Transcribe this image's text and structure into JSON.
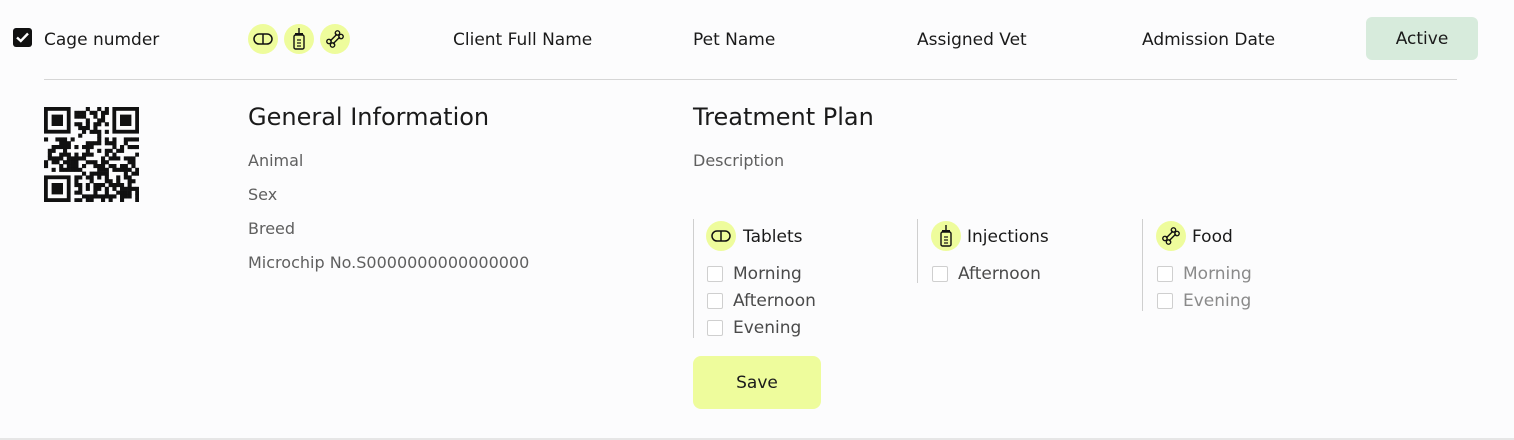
{
  "row": {
    "cage_label": "Cage numder",
    "client_label": "Client Full Name",
    "pet_label": "Pet Name",
    "vet_label": "Assigned Vet",
    "admission_label": "Admission Date",
    "status_label": "Active",
    "icons": [
      "pill-icon",
      "vial-icon",
      "bone-icon"
    ]
  },
  "general": {
    "title": "General Information",
    "animal": "Animal",
    "sex": "Sex",
    "breed": "Breed",
    "microchip": "Microchip No.S0000000000000000"
  },
  "treatment": {
    "title": "Treatment Plan",
    "description": "Description",
    "groups": [
      {
        "title": "Tablets",
        "icon": "pill-icon",
        "options": [
          "Morning",
          "Afternoon",
          "Evening"
        ]
      },
      {
        "title": "Injections",
        "icon": "vial-icon",
        "options": [
          "Afternoon"
        ]
      },
      {
        "title": "Food",
        "icon": "bone-icon",
        "options": [
          "Morning",
          "Evening"
        ]
      }
    ],
    "save_label": "Save"
  },
  "colors": {
    "accent": "#eefc9c",
    "status_bg": "#d7ebdc"
  }
}
